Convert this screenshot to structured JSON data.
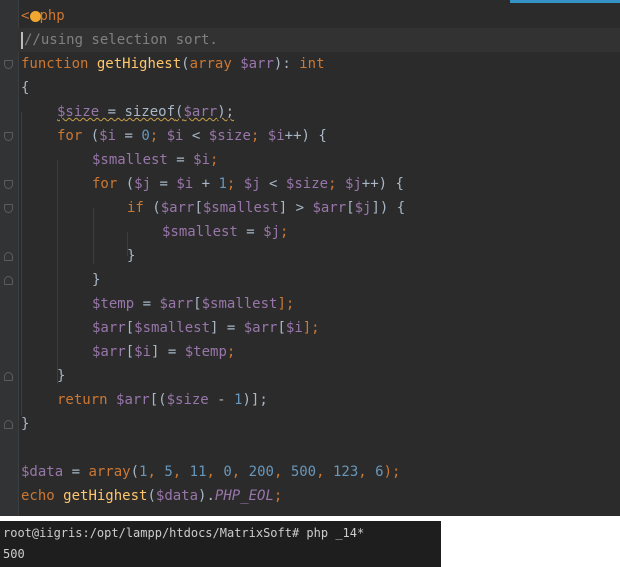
{
  "editor": {
    "line1": {
      "open": "<",
      "tail": "php"
    },
    "line2": "//using selection sort.",
    "line3": {
      "function": "function",
      "name": "getHighest",
      "open": "(",
      "type": "array",
      "param": "$arr",
      "close": "): ",
      "ret": "int"
    },
    "line4": "{",
    "line5": {
      "var": "$size",
      "eq": " = ",
      "fn": "sizeof",
      "open": "(",
      "arg": "$arr",
      "close": ");"
    },
    "line6": {
      "kw": "for",
      "a": " (",
      "i": "$i",
      "b": " = ",
      "zero": "0",
      "c": "; ",
      "i2": "$i",
      "d": " < ",
      "size": "$size",
      "e": "; ",
      "i3": "$i",
      "f": "++) {"
    },
    "line7": {
      "var": "$smallest",
      "eq": " = ",
      "i": "$i",
      "end": ";"
    },
    "line8": {
      "kw": "for",
      "a": " (",
      "j": "$j",
      "b": " = ",
      "i": "$i",
      "c": " + ",
      "one": "1",
      "d": "; ",
      "j2": "$j",
      "e": " < ",
      "size": "$size",
      "f": "; ",
      "j3": "$j",
      "g": "++) {"
    },
    "line9": {
      "kw": "if",
      "a": " (",
      "arr": "$arr",
      "b": "[",
      "s": "$smallest",
      "c": "] > ",
      "arr2": "$arr",
      "d": "[",
      "j": "$j",
      "e": "]) {"
    },
    "line10": {
      "var": "$smallest",
      "eq": " = ",
      "j": "$j",
      "end": ";"
    },
    "line11": "}",
    "line12": "}",
    "line13": {
      "var": "$temp",
      "eq": " = ",
      "arr": "$arr",
      "a": "[",
      "s": "$smallest",
      "b": "];"
    },
    "line14": {
      "arr": "$arr",
      "a": "[",
      "s": "$smallest",
      "b": "] = ",
      "arr2": "$arr",
      "c": "[",
      "i": "$i",
      "d": "];"
    },
    "line15": {
      "arr": "$arr",
      "a": "[",
      "i": "$i",
      "b": "] = ",
      "t": "$temp",
      "end": ";"
    },
    "line16": "}",
    "line17": {
      "kw": "return",
      "sp": " ",
      "arr": "$arr",
      "a": "[(",
      "size": "$size",
      "b": " - ",
      "one": "1",
      "c": ")];"
    },
    "line18": "}",
    "line20": {
      "var": "$data",
      "eq": " = ",
      "fn": "array",
      "open": "(",
      "n1": "1",
      "n2": "5",
      "n3": "11",
      "n4": "0",
      "n5": "200",
      "n6": "500",
      "n7": "123",
      "n8": "6",
      "sep": ", ",
      "close": ");"
    },
    "line21": {
      "kw": "echo",
      "sp": " ",
      "fn": "getHighest",
      "open": "(",
      "arg": "$data",
      "close": ").",
      "const": "PHP_EOL",
      "end": ";"
    }
  },
  "terminal": {
    "prompt": "root@iigris:/opt/lampp/htdocs/MatrixSoft# php _14*",
    "output": "500"
  },
  "colors": {
    "editor_bg": "#2b2b2b",
    "keyword": "#cc7832",
    "function": "#ffc66d",
    "variable": "#9876aa",
    "number": "#6897bb",
    "comment": "#808080",
    "terminal_bg": "#1e1e1e"
  },
  "icons": {
    "intention_bulb": "lightbulb-icon",
    "fold_markers": "fold-marker-icon"
  }
}
